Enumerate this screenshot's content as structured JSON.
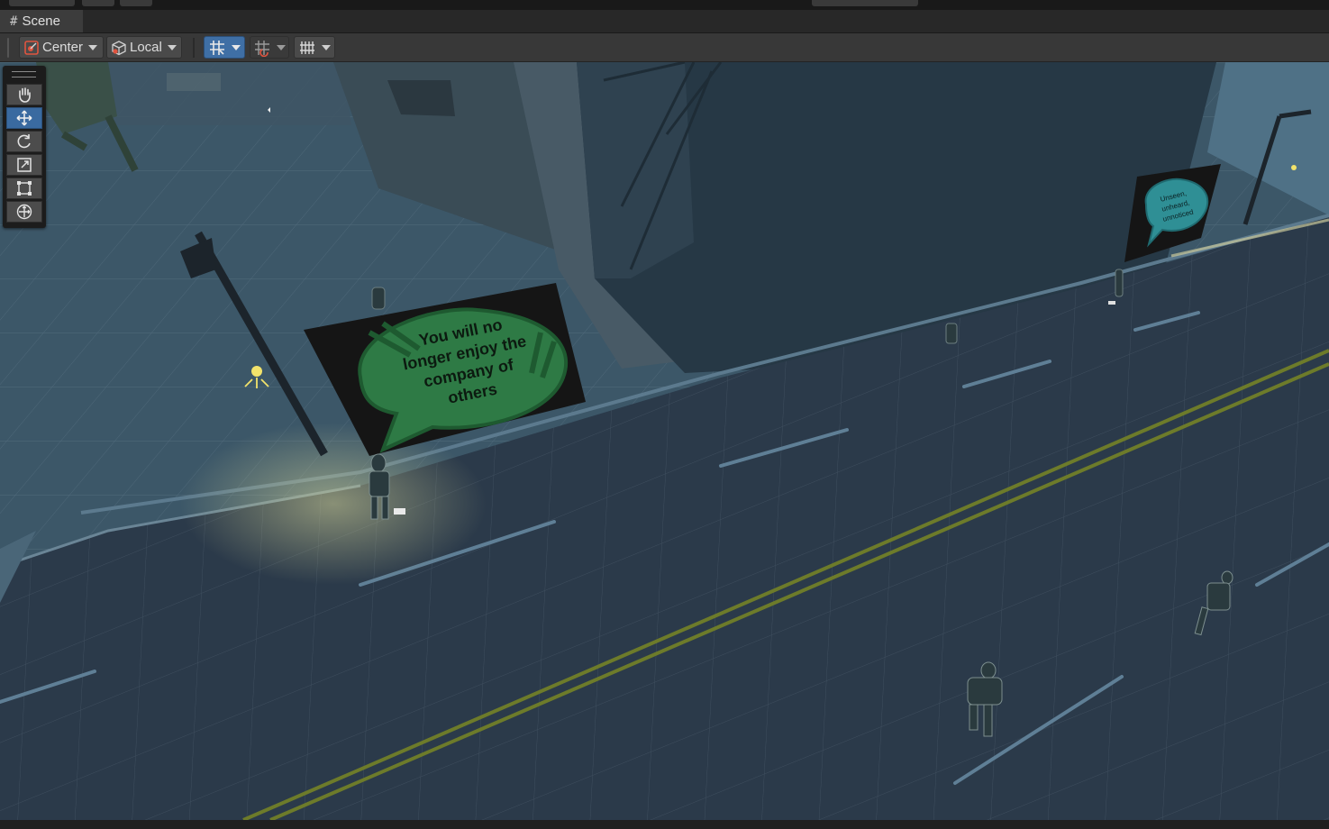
{
  "window": {
    "tab_title": "Scene"
  },
  "toolbar": {
    "pivot_mode_label": "Center",
    "pivot_rotation_label": "Local",
    "grid_snap_icon": "grid-snap-icon",
    "increment_snap_icon": "increment-snap-icon",
    "grid_visibility_icon": "grid-visibility-icon"
  },
  "tools": [
    {
      "name": "hand-tool",
      "icon": "hand-icon",
      "active": false
    },
    {
      "name": "move-tool",
      "icon": "move-arrows-icon",
      "active": true
    },
    {
      "name": "rotate-tool",
      "icon": "rotate-icon",
      "active": false
    },
    {
      "name": "scale-tool",
      "icon": "scale-icon",
      "active": false
    },
    {
      "name": "rect-tool",
      "icon": "rect-transform-icon",
      "active": false
    },
    {
      "name": "transform-tool",
      "icon": "transform-icon",
      "active": false
    }
  ],
  "scene": {
    "billboard_left_lines": [
      "You will no",
      "longer enjoy the",
      "company of",
      "others"
    ],
    "billboard_right_lines": [
      "Unseen,",
      "unheard,",
      "unnoticed"
    ]
  },
  "colors": {
    "accent": "#3f6fa5",
    "billboard_bubble_left": "#2e7a45",
    "billboard_bubble_right": "#2f8f95",
    "road_centerline": "#7a8a2a",
    "light_icon": "#f2e36b"
  }
}
